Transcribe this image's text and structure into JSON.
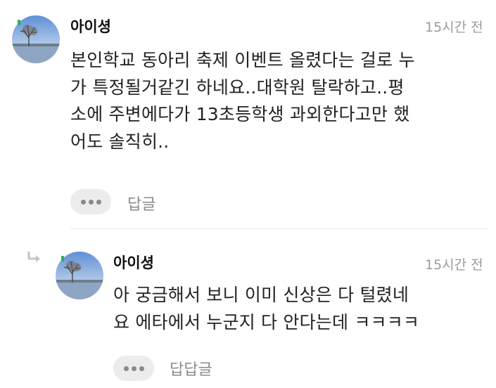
{
  "comments": [
    {
      "nickname": "아이셩",
      "time": "15시간 전",
      "lines": [
        "본인학교 동아리 축제 이벤트 올렸다는 걸로 누",
        "가 특정될거같긴 하네요..대학원 탈락하고..평",
        "소에 주변에다가 13초등학생 과외한다고만 했",
        "어도 솔직히.."
      ],
      "reply_label": "답글"
    },
    {
      "nickname": "아이셩",
      "time": "15시간 전",
      "lines": [
        "아 궁금해서 보니 이미 신상은 다 털렸네",
        "요 에타에서 누군지 다 안다는데 ㅋㅋㅋㅋ"
      ],
      "reply_label": "답답글"
    }
  ],
  "icons": {
    "reply_indicator": "reply-arrow-icon",
    "more": "more-dots-icon",
    "badge": "user-badge-icon"
  },
  "colors": {
    "badge": "#2fae5a",
    "muted": "#9a9a9a",
    "pill": "#ececec"
  }
}
